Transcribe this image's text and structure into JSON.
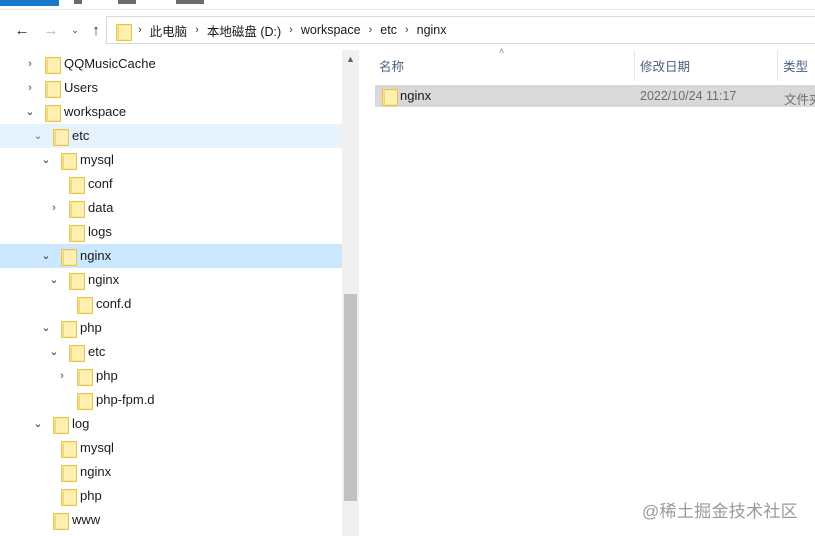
{
  "navigation": {
    "back_icon": "back-arrow-icon",
    "forward_icon": "forward-arrow-icon",
    "recent_icon": "chevron-down-icon",
    "up_icon": "up-arrow-icon"
  },
  "address_bar": {
    "crumbs": [
      "此电脑",
      "本地磁盘 (D:)",
      "workspace",
      "etc",
      "nginx"
    ]
  },
  "tree": {
    "items": [
      {
        "label": "QQMusicCache",
        "expander": "collapsed",
        "state": "normal"
      },
      {
        "label": "Users",
        "expander": "collapsed",
        "state": "normal"
      },
      {
        "label": "workspace",
        "expander": "expanded",
        "state": "normal"
      },
      {
        "label": "etc",
        "expander": "expanded",
        "state": "hovered"
      },
      {
        "label": "mysql",
        "expander": "expanded",
        "state": "normal"
      },
      {
        "label": "conf",
        "expander": "none",
        "state": "normal"
      },
      {
        "label": "data",
        "expander": "collapsed",
        "state": "normal"
      },
      {
        "label": "logs",
        "expander": "none",
        "state": "normal"
      },
      {
        "label": "nginx",
        "expander": "expanded",
        "state": "selected"
      },
      {
        "label": "nginx",
        "expander": "expanded",
        "state": "normal"
      },
      {
        "label": "conf.d",
        "expander": "none",
        "state": "normal"
      },
      {
        "label": "php",
        "expander": "expanded",
        "state": "normal"
      },
      {
        "label": "etc",
        "expander": "expanded",
        "state": "normal"
      },
      {
        "label": "php",
        "expander": "collapsed",
        "state": "normal"
      },
      {
        "label": "php-fpm.d",
        "expander": "none",
        "state": "normal"
      },
      {
        "label": "log",
        "expander": "expanded",
        "state": "normal"
      },
      {
        "label": "mysql",
        "expander": "none",
        "state": "normal"
      },
      {
        "label": "nginx",
        "expander": "none",
        "state": "normal"
      },
      {
        "label": "php",
        "expander": "none",
        "state": "normal"
      },
      {
        "label": "www",
        "expander": "none",
        "state": "normal"
      }
    ]
  },
  "details": {
    "columns": {
      "name": "名称",
      "modified": "修改日期",
      "type": "类型"
    },
    "files": [
      {
        "name": "nginx",
        "modified": "2022/10/24 11:17",
        "type": "文件夹"
      }
    ]
  },
  "watermark": "@稀土掘金技术社区",
  "colors": {
    "selected_row": "#cce8ff",
    "hover_row": "#e5f3ff",
    "folder": "#fde58b",
    "file_tab": "#1979ca"
  }
}
